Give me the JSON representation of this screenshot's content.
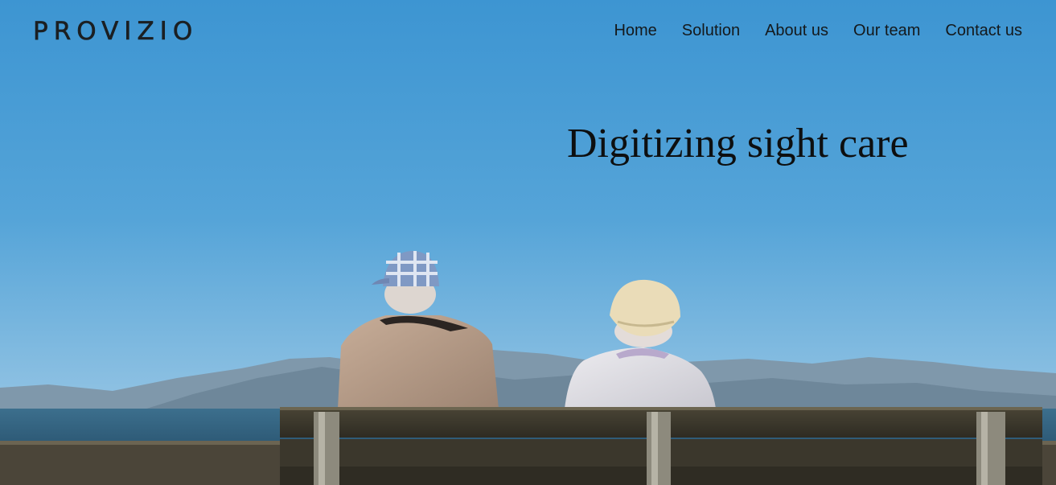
{
  "brand": {
    "name": "PROVIZIO"
  },
  "nav": {
    "items": [
      {
        "label": "Home"
      },
      {
        "label": "Solution"
      },
      {
        "label": "About us"
      },
      {
        "label": "Our team"
      },
      {
        "label": "Contact us"
      }
    ]
  },
  "hero": {
    "headline": "Digitizing sight care",
    "image": "elderly-couple-on-bench-facing-sea"
  },
  "colors": {
    "sky": "#4c9ed4",
    "text": "#14191c"
  }
}
